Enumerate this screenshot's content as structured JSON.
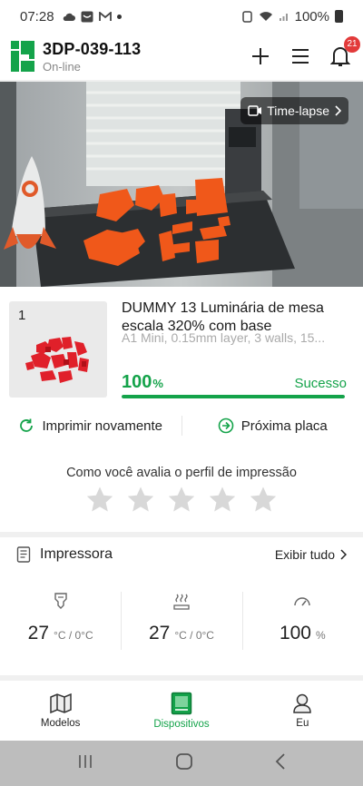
{
  "status_bar": {
    "time": "07:28",
    "battery": "100%"
  },
  "header": {
    "device_name": "3DP-039-113",
    "device_status": "On-line",
    "notification_count": "21",
    "icons": [
      "add-icon",
      "menu-icon",
      "bell-icon"
    ]
  },
  "camera": {
    "timelapse_label": "Time-lapse"
  },
  "job": {
    "plate_number": "1",
    "title": "DUMMY 13 Luminária de mesa escala 320% com base",
    "meta": "A1 Mini, 0.15mm layer, 3 walls, 15...",
    "progress": 100,
    "progress_value": "100",
    "progress_unit": "%",
    "status": "Sucesso",
    "reprint_label": "Imprimir novamente",
    "next_plate_label": "Próxima placa",
    "rating_prompt": "Como você avalia o perfil de impressão",
    "rating_stars": 5,
    "rating_value": 0
  },
  "printer": {
    "title": "Impressora",
    "view_all": "Exibir tudo",
    "nozzle_temp": "27",
    "nozzle_unit": "°C / 0°C",
    "bed_temp": "27",
    "bed_unit": "°C / 0°C",
    "fan_speed": "100",
    "fan_unit": "%"
  },
  "bottom_nav": {
    "items": [
      {
        "label": "Modelos",
        "icon": "models-icon"
      },
      {
        "label": "Dispositivos",
        "icon": "devices-icon"
      },
      {
        "label": "Eu",
        "icon": "profile-icon"
      }
    ],
    "active": "Dispositivos"
  },
  "colors": {
    "accent": "#14a34a",
    "badge": "#e23a3a"
  }
}
